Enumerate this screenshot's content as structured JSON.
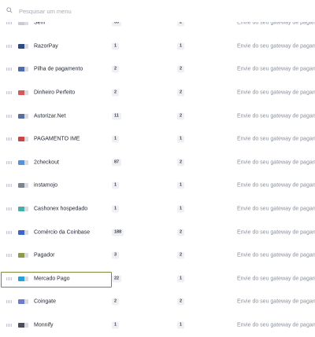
{
  "search": {
    "placeholder": "Pesquisar um menu"
  },
  "common_desc": "Envie do seu gateway de pagan",
  "colors": {
    "selected_border": "#7a8a3a",
    "badge_bg": "#eef0f3"
  },
  "rows": [
    {
      "name": "Sem",
      "count": "33",
      "order": "2",
      "desc": "Envie do seu gateway de pagan",
      "logo": "#c9ccd3"
    },
    {
      "name": "RazorPay",
      "count": "1",
      "order": "1",
      "desc": "Envie do seu gateway de pagan",
      "logo": "#2c4a86"
    },
    {
      "name": "Pilha de pagamento",
      "count": "2",
      "order": "2",
      "desc": "Envie do seu gateway de pagan",
      "logo": "#4e6bb0"
    },
    {
      "name": "Dinheiro Perfeito",
      "count": "2",
      "order": "2",
      "desc": "Envie do seu gateway de pagan",
      "logo": "#d35a5a"
    },
    {
      "name": "Autorizar.Net",
      "count": "11",
      "order": "2",
      "desc": "Envie do seu gateway de pagan",
      "logo": "#5a6fa0"
    },
    {
      "name": "PAGAMENTO IME",
      "count": "1",
      "order": "1",
      "desc": "Envie do seu gateway de pagan",
      "logo": "#c64545"
    },
    {
      "name": "2checkout",
      "count": "87",
      "order": "2",
      "desc": "Envie do seu gateway de pagan",
      "logo": "#5b8fd6"
    },
    {
      "name": "instamojo",
      "count": "1",
      "order": "1",
      "desc": "Envie do seu gateway de pagan",
      "logo": "#7f8590"
    },
    {
      "name": "Cashonex hospedado",
      "count": "1",
      "order": "1",
      "desc": "Envie do seu gateway de pagan",
      "logo": "#47b0a5"
    },
    {
      "name": "Comércio da Coinbase",
      "count": "188",
      "order": "2",
      "desc": "Envie do seu gateway de pagan",
      "logo": "#3d64c8"
    },
    {
      "name": "Pagador",
      "count": "3",
      "order": "2",
      "desc": "Envie do seu gateway de pagan",
      "logo": "#8a9c4a"
    },
    {
      "name": "Mercado Pago",
      "count": "22",
      "order": "1",
      "desc": "Envie do seu gateway de pagan",
      "logo": "#2aa0d8",
      "selected": true
    },
    {
      "name": "Coingate",
      "count": "2",
      "order": "2",
      "desc": "Envie do seu gateway de pagan",
      "logo": "#6b7cc9"
    },
    {
      "name": "Monnify",
      "count": "1",
      "order": "1",
      "desc": "Envie do seu gateway de pagan",
      "logo": "#4a4f5a"
    }
  ]
}
